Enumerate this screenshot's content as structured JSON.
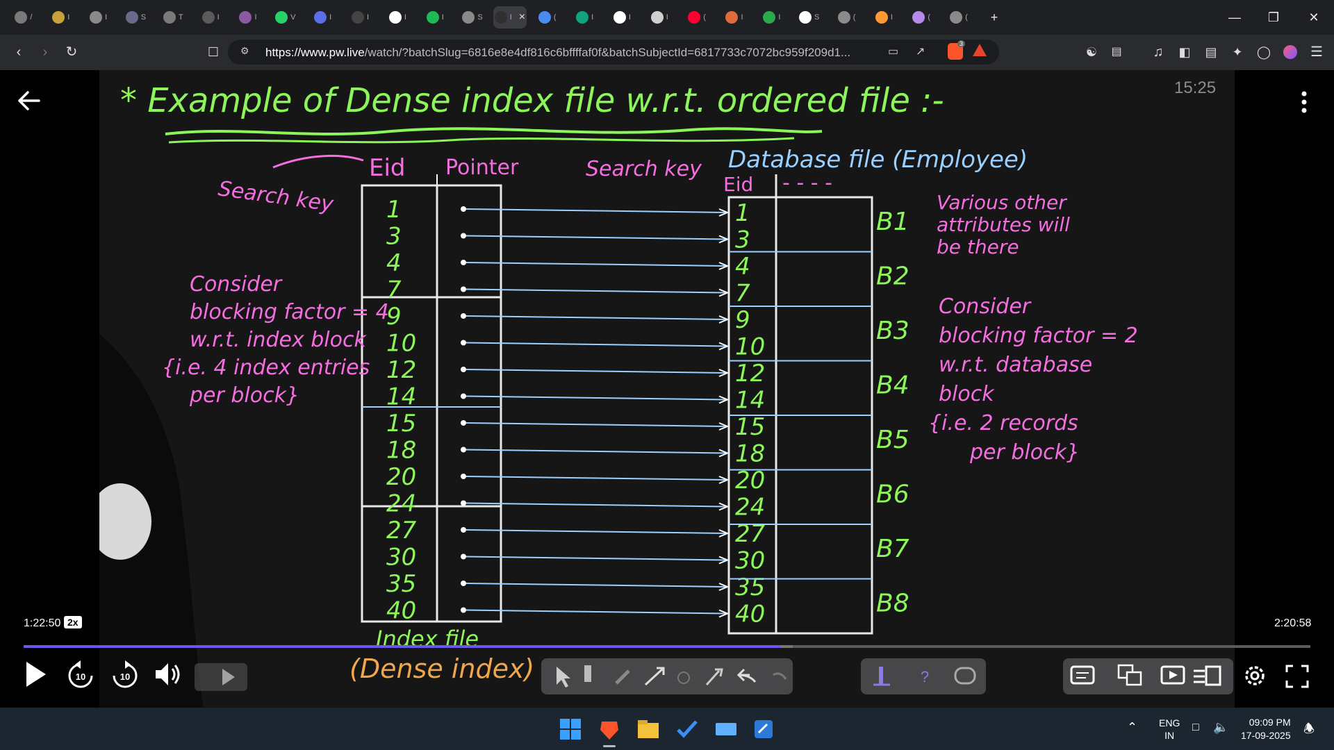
{
  "browser": {
    "tabs": [
      {
        "label": "/",
        "icon": "chatgpt-icon",
        "color": "#7a7a7a"
      },
      {
        "label": "I",
        "icon": "site-icon",
        "color": "#c7a13a"
      },
      {
        "label": "I",
        "icon": "globe-icon",
        "color": "#8a8a8a"
      },
      {
        "label": "S",
        "icon": "site-icon",
        "color": "#6a6a8a"
      },
      {
        "label": "T",
        "icon": "wordpress-icon",
        "color": "#7a7a7a"
      },
      {
        "label": "I",
        "icon": "site-icon",
        "color": "#5a5a5a"
      },
      {
        "label": "I",
        "icon": "site-icon",
        "color": "#8a5aa0"
      },
      {
        "label": "V",
        "icon": "whatsapp-icon",
        "color": "#25d366"
      },
      {
        "label": "I",
        "icon": "bookmark-icon",
        "color": "#5a6ee8"
      },
      {
        "label": "I",
        "icon": "site-icon",
        "color": "#444"
      },
      {
        "label": "I",
        "icon": "google-icon",
        "color": "#ffffff"
      },
      {
        "label": "I",
        "icon": "spotify-icon",
        "color": "#1db954"
      },
      {
        "label": "S",
        "icon": "globe-icon",
        "color": "#8a8a8a"
      },
      {
        "label": "I",
        "icon": "site-icon",
        "color": "#2f2f2f",
        "active": true
      },
      {
        "label": "(",
        "icon": "gemini-icon",
        "color": "#4a8bf0"
      },
      {
        "label": "I",
        "icon": "chatgpt-icon",
        "color": "#10a37f"
      },
      {
        "label": "I",
        "icon": "google-icon",
        "color": "#ffffff"
      },
      {
        "label": "I",
        "icon": "site-icon",
        "color": "#cfcfcf"
      },
      {
        "label": "(",
        "icon": "youtube-icon",
        "color": "#ff0033"
      },
      {
        "label": "I",
        "icon": "site-icon",
        "color": "#e06a3a"
      },
      {
        "label": "I",
        "icon": "site-icon",
        "color": "#2aa84a"
      },
      {
        "label": "S",
        "icon": "wikipedia-icon",
        "color": "#ffffff"
      },
      {
        "label": "(",
        "icon": "globe-icon",
        "color": "#8a8a8a"
      },
      {
        "label": "I",
        "icon": "india-flag-icon",
        "color": "#ff9933"
      },
      {
        "label": "(",
        "icon": "site-icon",
        "color": "#b58ae8"
      },
      {
        "label": "(",
        "icon": "globe-icon",
        "color": "#8a8a8a"
      }
    ],
    "url_domain": "https://www.pw.live",
    "url_path": "/watch/?batchSlug=6816e8e4df816c6bffffaf0f&batchSubjectId=6817733c7072bc959f209d1...",
    "brave_badge": "3"
  },
  "player": {
    "clock": "15:25",
    "current_time": "1:22:50",
    "speed": "2x",
    "duration": "2:20:58",
    "progress": 0.588,
    "skip_back": "10",
    "skip_forward": "10"
  },
  "board": {
    "title": "* Example of Dense index file w.r.t. ordered file :-",
    "search_key_left": "Search key",
    "col_eid": "Eid",
    "col_pointer": "Pointer",
    "search_key_right": "Search key",
    "db_file": "Database file (Employee)",
    "db_eid": "Eid",
    "db_dashes": "- - - -",
    "index_values": [
      "1",
      "3",
      "4",
      "7",
      "9",
      "10",
      "12",
      "14",
      "15",
      "18",
      "20",
      "24",
      "27",
      "30",
      "35",
      "40"
    ],
    "block_labels": [
      "B1",
      "B2",
      "B3",
      "B4",
      "B5",
      "B6",
      "B7",
      "B8"
    ],
    "left_note": [
      "Consider",
      "blocking factor = 4",
      "w.r.t. index block",
      "{i.e. 4 index entries",
      "per block}"
    ],
    "right_top_note": [
      "Various other",
      "attributes will",
      "be there"
    ],
    "right_note": [
      "Consider",
      "blocking factor = 2",
      "w.r.t. database",
      "block",
      "{i.e. 2 records",
      "per block}"
    ],
    "index_caption": [
      "Index file",
      "(Dense index)"
    ]
  },
  "taskbar": {
    "lang_top": "ENG",
    "lang_bottom": "IN",
    "time": "09:09 PM",
    "date": "17-09-2025"
  }
}
